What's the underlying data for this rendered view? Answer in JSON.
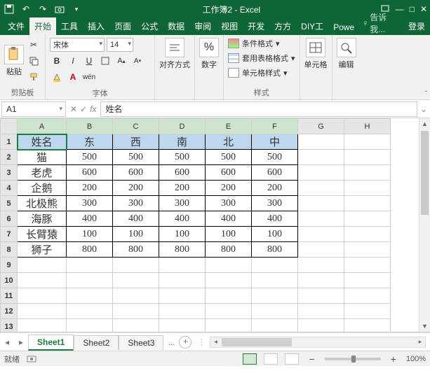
{
  "window": {
    "title": "工作簿2 - Excel"
  },
  "menu": {
    "file": "文件",
    "home": "开始",
    "tools": "工具",
    "insert": "插入",
    "page": "页面",
    "formulas": "公式",
    "data": "数据",
    "review": "审阅",
    "view": "视图",
    "developer": "开发",
    "fangfang": "方方",
    "diy": "DIY工",
    "power": "Powe",
    "tell": "告诉我...",
    "login": "登录"
  },
  "ribbon": {
    "paste": "粘贴",
    "clipboard": "剪贴板",
    "font_name": "宋体",
    "font_size": "14",
    "bold": "B",
    "italic": "I",
    "underline": "U",
    "wen": "wén",
    "font_group": "字体",
    "align": "对齐方式",
    "number": "数字",
    "cond_format": "条件格式",
    "table_format": "套用表格格式",
    "cell_style": "单元格样式",
    "styles": "样式",
    "cells": "单元格",
    "editing": "编辑"
  },
  "namebox": "A1",
  "formula": "姓名",
  "columns": [
    "A",
    "B",
    "C",
    "D",
    "E",
    "F",
    "G",
    "H"
  ],
  "headers": [
    "姓名",
    "东",
    "西",
    "南",
    "北",
    "中"
  ],
  "rows": [
    {
      "n": "猫",
      "v": [
        500,
        500,
        500,
        500,
        500
      ]
    },
    {
      "n": "老虎",
      "v": [
        600,
        600,
        600,
        600,
        600
      ]
    },
    {
      "n": "企鹅",
      "v": [
        200,
        200,
        200,
        200,
        200
      ]
    },
    {
      "n": "北极熊",
      "v": [
        300,
        300,
        300,
        300,
        300
      ]
    },
    {
      "n": "海豚",
      "v": [
        400,
        400,
        400,
        400,
        400
      ]
    },
    {
      "n": "长臂猿",
      "v": [
        100,
        100,
        100,
        100,
        100
      ]
    },
    {
      "n": "狮子",
      "v": [
        800,
        800,
        800,
        800,
        800
      ]
    }
  ],
  "sheets": {
    "s1": "Sheet1",
    "s2": "Sheet2",
    "s3": "Sheet3",
    "more": "..."
  },
  "status": {
    "ready": "就绪",
    "zoom": "100%"
  }
}
